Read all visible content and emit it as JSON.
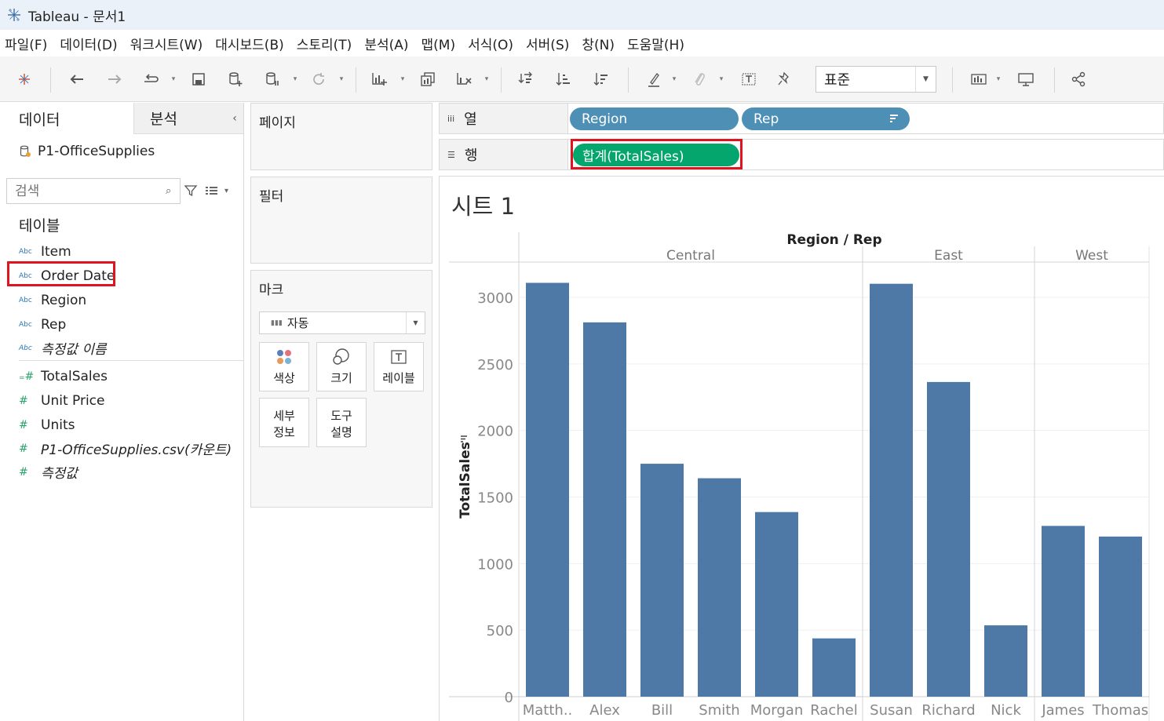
{
  "window": {
    "title": "Tableau - 문서1"
  },
  "menu": [
    "파일(F)",
    "데이터(D)",
    "워크시트(W)",
    "대시보드(B)",
    "스토리(T)",
    "분석(A)",
    "맵(M)",
    "서식(O)",
    "서버(S)",
    "창(N)",
    "도움말(H)"
  ],
  "toolbar": {
    "fit_value": "표준"
  },
  "data_pane": {
    "tab_data": "데이터",
    "tab_analysis": "분석",
    "datasource": "P1-OfficeSupplies",
    "search_placeholder": "검색",
    "tables_header": "테이블",
    "type_abc": "Abc",
    "type_num": "#",
    "dimensions": [
      "Item",
      "Order Date",
      "Region",
      "Rep",
      "측정값 이름"
    ],
    "measures": [
      "TotalSales",
      "Unit Price",
      "Units",
      "P1-OfficeSupplies.csv(카운트)",
      "측정값"
    ]
  },
  "cards": {
    "pages": "페이지",
    "filters": "필터",
    "marks": "마크",
    "marks_type": "자동",
    "mark_buttons": {
      "color": "색상",
      "size": "크기",
      "label": "레이블",
      "detail": "세부\n정보",
      "tooltip": "도구\n설명"
    }
  },
  "shelves": {
    "columns_label": "열",
    "rows_label": "행",
    "columns_pills": [
      "Region",
      "Rep"
    ],
    "rows_pill": "합계(TotalSales)"
  },
  "sheet": {
    "title": "시트 1"
  },
  "colors": {
    "bar": "#4e79a7",
    "measure_pill": "#05a66e",
    "dimension_pill": "#4e8fb5",
    "highlight": "#e0141e"
  },
  "chart_data": {
    "type": "bar",
    "header_title": "Region / Rep",
    "ylabel": "TotalSales",
    "ylim": [
      0,
      3000
    ],
    "yticks": [
      0,
      500,
      1000,
      1500,
      2000,
      2500,
      3000
    ],
    "regions": [
      {
        "name": "Central",
        "reps": [
          "Matth..",
          "Alex",
          "Bill",
          "Smith",
          "Morgan",
          "Rachel"
        ],
        "values": [
          3109,
          2812,
          1750,
          1641,
          1387,
          438
        ]
      },
      {
        "name": "East",
        "reps": [
          "Susan",
          "Richard",
          "Nick"
        ],
        "values": [
          3102,
          2364,
          536
        ]
      },
      {
        "name": "West",
        "reps": [
          "James",
          "Thomas"
        ],
        "values": [
          1283,
          1203
        ]
      }
    ]
  }
}
